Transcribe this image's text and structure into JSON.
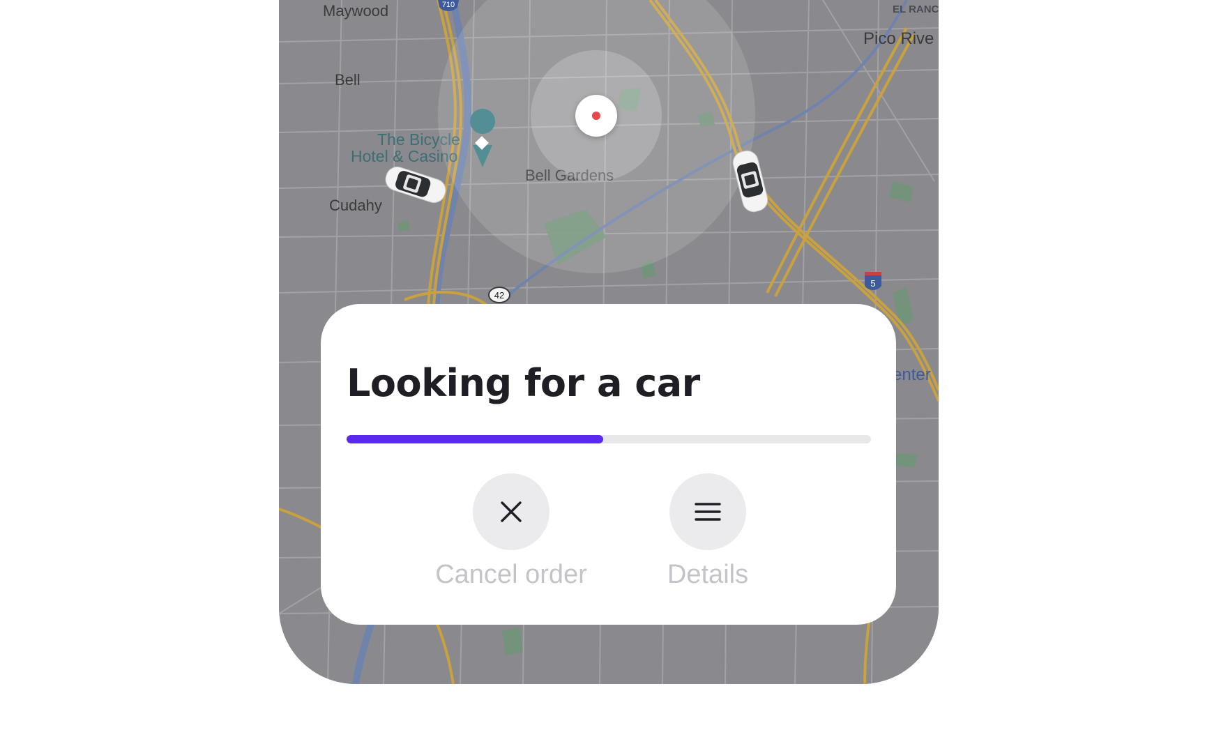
{
  "map": {
    "labels": {
      "maywood": "Maywood",
      "bell": "Bell",
      "casino_line1": "The Bicycle",
      "casino_line2": "Hotel & Casino",
      "cudahy": "Cudahy",
      "bell_gardens": "Bell Gardens",
      "el_rancho": "EL RANC",
      "pico_rivera": "Pico Rive",
      "center": "enter"
    },
    "shields": {
      "i710": "710",
      "route42": "42",
      "i5": "5"
    }
  },
  "status": {
    "title": "Looking for a car",
    "progress": 0.49
  },
  "actions": {
    "cancel_label": "Cancel order",
    "details_label": "Details"
  },
  "colors": {
    "accent": "#5a28f0",
    "pin_dot": "#e8474b",
    "map_base": "#8a8a8e",
    "road_major": "#c9a13e",
    "water": "#6f83ad",
    "park": "#6f9477"
  },
  "icons": {
    "cancel": "close-icon",
    "details": "menu-icon",
    "pin": "location-pin-icon",
    "cars": "car-icon"
  }
}
